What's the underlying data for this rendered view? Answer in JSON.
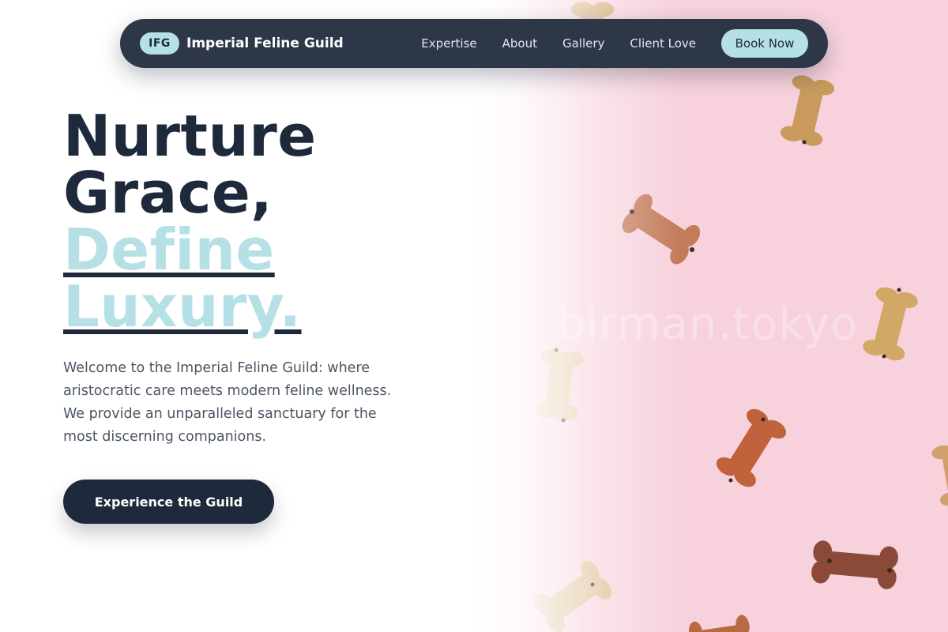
{
  "brand": {
    "badge": "IFG",
    "name": "Imperial Feline Guild"
  },
  "nav": {
    "links": [
      "Expertise",
      "About",
      "Gallery",
      "Client Love"
    ],
    "cta": "Book Now"
  },
  "hero": {
    "headline_dark": [
      "Nurture",
      "Grace,"
    ],
    "headline_accent": [
      "Define",
      "Luxury."
    ],
    "intro": "Welcome to the Imperial Feline Guild: where aristocratic care meets modern feline wellness. We provide an unparalleled sanctuary for the most discerning companions.",
    "cta": "Experience the Guild",
    "image_watermark": "birman.tokyo"
  },
  "colors": {
    "navy": "#1e293b",
    "nav_bg": "#2e3748",
    "accent": "#b4e0e6",
    "hero_image_bg": "#f7d2dc",
    "body_text": "#4b5563"
  }
}
